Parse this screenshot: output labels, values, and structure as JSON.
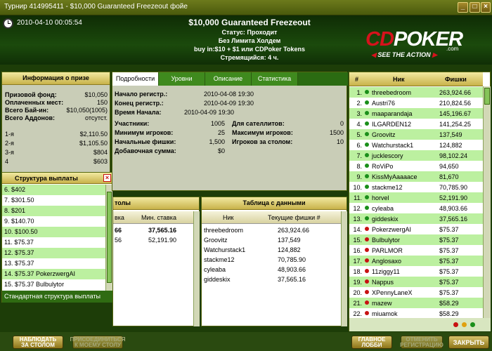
{
  "window": {
    "title": "Турнир 414995411 - $10,000 Guaranteed Freezeout фойе"
  },
  "header": {
    "datetime": "2010-04-10 00:05:54",
    "name": "$10,000 Guaranteed Freezeout",
    "status": "Статус: Проходит",
    "game": "Без Лимита Холдем",
    "buyin": "buy in:$10 + $1 или CDPoker Tokens",
    "speed": "Стремящийся: 4 ч."
  },
  "logo": {
    "cd": "CD",
    "poker": "POKER",
    "com": ".com",
    "tagline": "SEE THE ACTION"
  },
  "prize_info": {
    "title": "Информация о призе",
    "rows": [
      {
        "label": "Призовой фонд:",
        "value": "$10,050"
      },
      {
        "label": "Оплаченных мест:",
        "value": "150"
      },
      {
        "label": "Всего Бай-ин:",
        "value": "$10,050(1005)"
      },
      {
        "label": "Всего Аддонов:",
        "value": "отсутст."
      }
    ],
    "places": [
      {
        "label": "1-я",
        "value": "$2,110.50"
      },
      {
        "label": "2-я",
        "value": "$1,105.50"
      },
      {
        "label": "3-я",
        "value": "$804"
      },
      {
        "label": "4",
        "value": "$603"
      }
    ]
  },
  "payout": {
    "title": "Структура выплаты",
    "items": [
      "6. $402",
      "7. $301.50",
      "8. $201",
      "9. $140.70",
      "10. $100.50",
      "11. $75.37",
      "12. $75.37",
      "13. $75.37",
      "14. $75.37 PokerzwergAI",
      "15. $75.37 Bulbulytor"
    ],
    "footer": "Стандартная структура выплаты"
  },
  "tabs": [
    "Подробности",
    "Уровни",
    "Описание",
    "Статистика"
  ],
  "details": {
    "left": [
      {
        "label": "Начало регистр.:",
        "value": "2010-04-08 19:30"
      },
      {
        "label": "Конец регистр.:",
        "value": "2010-04-09 19:30"
      },
      {
        "label": "Время Начала:",
        "value": "2010-04-09 19:30"
      },
      {
        "label": "Участники:",
        "value": "1005"
      },
      {
        "label": "Минимум игроков:",
        "value": "25"
      },
      {
        "label": "Начальные фишки:",
        "value": "1,500"
      },
      {
        "label": "Добавочная сумма:",
        "value": "$0"
      }
    ],
    "right": [
      {
        "label": "Для сателлитов:",
        "value": "0"
      },
      {
        "label": "Максимум игроков:",
        "value": "1500"
      },
      {
        "label": "Игроков за столом:",
        "value": "10"
      }
    ]
  },
  "tables_panel": {
    "title": "толы",
    "col_a": "вка",
    "col_b": "Мин. ставка",
    "rows": [
      {
        "a": "66",
        "b": "37,565.16"
      },
      {
        "a": "56",
        "b": "52,191.90"
      }
    ]
  },
  "data_table": {
    "title": "Таблица с данными",
    "col_nick": "Ник",
    "col_chips": "Текущие фишки #",
    "rows": [
      {
        "nick": "threebedroom",
        "chips": "263,924.66"
      },
      {
        "nick": "Groovitz",
        "chips": "137,549"
      },
      {
        "nick": "Watchurstack1",
        "chips": "124,882"
      },
      {
        "nick": "stackme12",
        "chips": "70,785.90"
      },
      {
        "nick": "cyleaba",
        "chips": "48,903.66"
      },
      {
        "nick": "giddeskix",
        "chips": "37,565.16"
      }
    ]
  },
  "players": {
    "col_num": "#",
    "col_nick": "Ник",
    "col_chips": "Фишки",
    "rows": [
      {
        "n": "1.",
        "nick": "threebedroom",
        "chips": "263,924.66",
        "c": "#1a8f1a"
      },
      {
        "n": "2.",
        "nick": "Austri76",
        "chips": "210,824.56",
        "c": "#1a8f1a"
      },
      {
        "n": "3.",
        "nick": "maaparandaja",
        "chips": "145,196.67",
        "c": "#1a8f1a"
      },
      {
        "n": "4.",
        "nick": "ILGARDEN12",
        "chips": "141,254.25",
        "c": "#1a8f1a"
      },
      {
        "n": "5.",
        "nick": "Groovitz",
        "chips": "137,549",
        "c": "#1a8f1a"
      },
      {
        "n": "6.",
        "nick": "Watchurstack1",
        "chips": "124,882",
        "c": "#1a8f1a"
      },
      {
        "n": "7.",
        "nick": "jucklescory",
        "chips": "98,102.24",
        "c": "#1a8f1a"
      },
      {
        "n": "8.",
        "nick": "RoViPo",
        "chips": "94,650",
        "c": "#1a8f1a"
      },
      {
        "n": "9.",
        "nick": "KissMyAaaaace",
        "chips": "81,670",
        "c": "#1a8f1a"
      },
      {
        "n": "10.",
        "nick": "stackme12",
        "chips": "70,785.90",
        "c": "#1a8f1a"
      },
      {
        "n": "11.",
        "nick": "horvel",
        "chips": "52,191.90",
        "c": "#1a8f1a"
      },
      {
        "n": "12.",
        "nick": "cyleaba",
        "chips": "48,903.66",
        "c": "#1a8f1a"
      },
      {
        "n": "13.",
        "nick": "giddeskix",
        "chips": "37,565.16",
        "c": "#1a8f1a"
      },
      {
        "n": "14.",
        "nick": "PokerzwergAI",
        "chips": "$75.37",
        "c": "#c81212"
      },
      {
        "n": "15.",
        "nick": "Bulbulytor",
        "chips": "$75.37",
        "c": "#c81212"
      },
      {
        "n": "16.",
        "nick": "PARLMOR",
        "chips": "$75.37",
        "c": "#c81212"
      },
      {
        "n": "17.",
        "nick": "Anglosaxo",
        "chips": "$75.37",
        "c": "#c81212"
      },
      {
        "n": "18.",
        "nick": "11ziggy11",
        "chips": "$75.37",
        "c": "#c81212"
      },
      {
        "n": "19.",
        "nick": "Nappus",
        "chips": "$75.37",
        "c": "#c81212"
      },
      {
        "n": "20.",
        "nick": "XPennyLaneX",
        "chips": "$75.37",
        "c": "#c81212"
      },
      {
        "n": "21.",
        "nick": "mazew",
        "chips": "$58.29",
        "c": "#c81212"
      },
      {
        "n": "22.",
        "nick": "miuamok",
        "chips": "$58.29",
        "c": "#c81212"
      }
    ]
  },
  "buttons": {
    "observe": [
      "НАБЛЮДАТЬ",
      "ЗА СТОЛОМ"
    ],
    "join": [
      "ПРИСОЕДИНИТЬСЯ",
      "К МОЕМУ СТОЛУ"
    ],
    "lobby": [
      "ГЛАВНОЕ",
      "ЛОББИ"
    ],
    "cancel": [
      "ОТМЕНИТЬ",
      "РЕГИСТРАЦИЮ"
    ],
    "close": "ЗАКРЫТЬ"
  },
  "colors": {
    "accent_green": "#3f8a1e",
    "brand_red": "#d6121c",
    "row_green": "#bcf0a0"
  }
}
